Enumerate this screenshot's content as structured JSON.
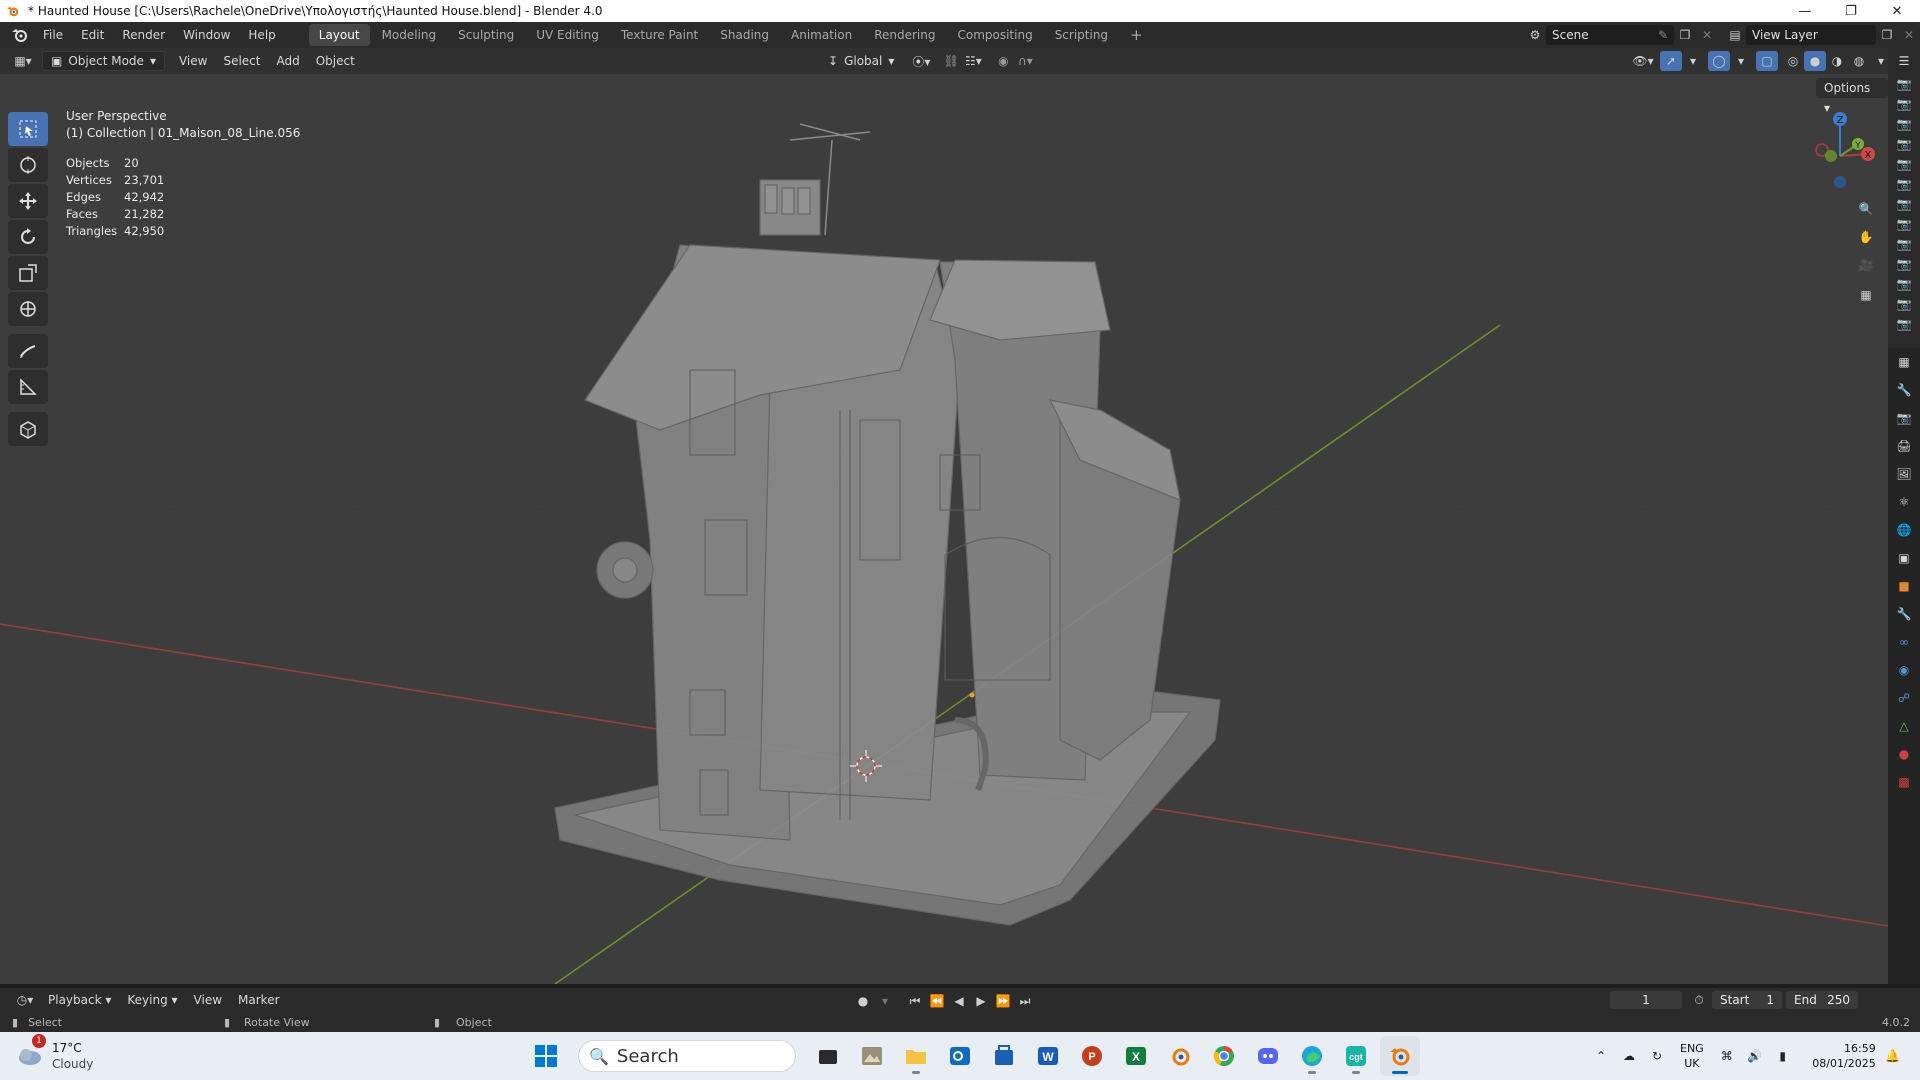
{
  "window": {
    "title": "* Haunted House [C:\\Users\\Rachele\\OneDrive\\Υπολογιστής\\Haunted House.blend] - Blender 4.0",
    "controls": [
      "minimize",
      "restore",
      "close"
    ]
  },
  "menu": [
    "File",
    "Edit",
    "Render",
    "Window",
    "Help"
  ],
  "workspaces": [
    "Layout",
    "Modeling",
    "Sculpting",
    "UV Editing",
    "Texture Paint",
    "Shading",
    "Animation",
    "Rendering",
    "Compositing",
    "Scripting"
  ],
  "active_workspace": "Layout",
  "scene": {
    "label": "Scene"
  },
  "view_layer": {
    "label": "View Layer"
  },
  "viewport_header": {
    "mode": "Object Mode",
    "menus": [
      "View",
      "Select",
      "Add",
      "Object"
    ],
    "transform_orientation": "Global"
  },
  "overlay": {
    "perspective": "User Perspective",
    "collection": "(1) Collection | 01_Maison_08_Line.056",
    "options_label": "Options"
  },
  "stats": [
    {
      "label": "Objects",
      "value": "20"
    },
    {
      "label": "Vertices",
      "value": "23,701"
    },
    {
      "label": "Edges",
      "value": "42,942"
    },
    {
      "label": "Faces",
      "value": "21,282"
    },
    {
      "label": "Triangles",
      "value": "42,950"
    }
  ],
  "gizmo": {
    "x": "X",
    "y": "Y",
    "z": "Z"
  },
  "timeline": {
    "menus": [
      "Playback",
      "Keying",
      "View",
      "Marker"
    ],
    "current_frame": "1",
    "start_label": "Start",
    "start": "1",
    "end_label": "End",
    "end": "250"
  },
  "statusbar": {
    "left": "Select",
    "middle": "Rotate View",
    "right": "Object",
    "version": "4.0.2"
  },
  "taskbar": {
    "weather_temp": "17°C",
    "weather_desc": "Cloudy",
    "weather_badge": "1",
    "search_placeholder": "Search",
    "lang_top": "ENG",
    "lang_bottom": "UK",
    "time": "16:59",
    "date": "08/01/2025"
  },
  "colors": {
    "accent": "#4772b3",
    "x_axis": "#b33a3a",
    "y_axis": "#6a9a2a",
    "z_axis": "#3a7bd5"
  }
}
